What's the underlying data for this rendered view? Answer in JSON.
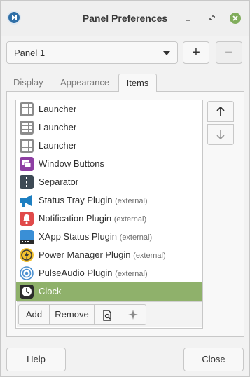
{
  "window": {
    "title": "Panel Preferences"
  },
  "panel_selector": {
    "selected": "Panel 1",
    "add_label": "+",
    "remove_label": "−"
  },
  "tabs": [
    {
      "label": "Display"
    },
    {
      "label": "Appearance"
    },
    {
      "label": "Items",
      "active": true
    }
  ],
  "items": [
    {
      "name": "Launcher",
      "ext": "",
      "icon": "launcher-icon"
    },
    {
      "name": "Launcher",
      "ext": "",
      "icon": "launcher-icon"
    },
    {
      "name": "Launcher",
      "ext": "",
      "icon": "launcher-icon"
    },
    {
      "name": "Window Buttons",
      "ext": "",
      "icon": "window-buttons-icon"
    },
    {
      "name": "Separator",
      "ext": "",
      "icon": "separator-icon"
    },
    {
      "name": "Status Tray Plugin",
      "ext": "(external)",
      "icon": "megaphone-icon"
    },
    {
      "name": "Notification Plugin",
      "ext": "(external)",
      "icon": "bell-icon"
    },
    {
      "name": "XApp Status Plugin",
      "ext": "(external)",
      "icon": "xapp-icon"
    },
    {
      "name": "Power Manager Plugin",
      "ext": "(external)",
      "icon": "power-icon"
    },
    {
      "name": "PulseAudio Plugin",
      "ext": "(external)",
      "icon": "audio-icon"
    },
    {
      "name": "Clock",
      "ext": "",
      "icon": "clock-icon",
      "selected": true
    }
  ],
  "list_toolbar": {
    "add_label": "Add",
    "remove_label": "Remove"
  },
  "buttons": {
    "help": "Help",
    "close": "Close"
  },
  "colors": {
    "selection": "#8fb16b",
    "close_button": "#81ad5c"
  }
}
